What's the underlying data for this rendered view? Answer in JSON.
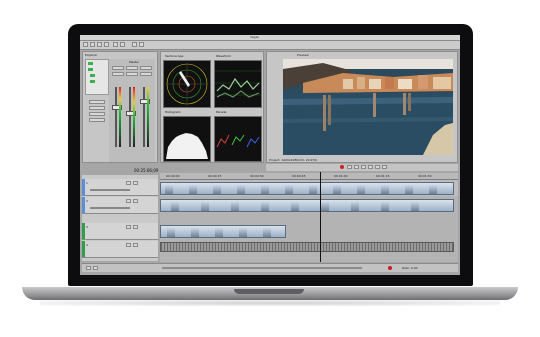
{
  "app": {
    "window_title": "Vegas",
    "menu_items": [
      "File",
      "Edit",
      "View",
      "Insert",
      "Tools",
      "Options",
      "Help"
    ]
  },
  "explorer": {
    "tabs": [
      "Explorer",
      "Project Media"
    ]
  },
  "mixer": {
    "labels": [
      "Master",
      "Preview"
    ]
  },
  "scopes": {
    "titles": [
      "Vectorscope",
      "Waveform",
      "Histogram",
      "Parade"
    ]
  },
  "preview": {
    "label": "Preview",
    "info": "Project: 1920x1080x32, 29.970i"
  },
  "timeline": {
    "timecode": "00:25:06;09",
    "ruler_marks": [
      "00:00:00",
      "00:00:15",
      "00:00:30",
      "00:00:45",
      "00:01:00",
      "00:01:15",
      "00:01:30"
    ],
    "track_numbers": [
      "1",
      "2",
      "3",
      "4"
    ]
  },
  "transport": {
    "rate": "Rate: 0.00"
  },
  "colors": {
    "accent": "#c82020",
    "video_track": "#5a8fd8",
    "audio_track": "#2e9e4c"
  }
}
